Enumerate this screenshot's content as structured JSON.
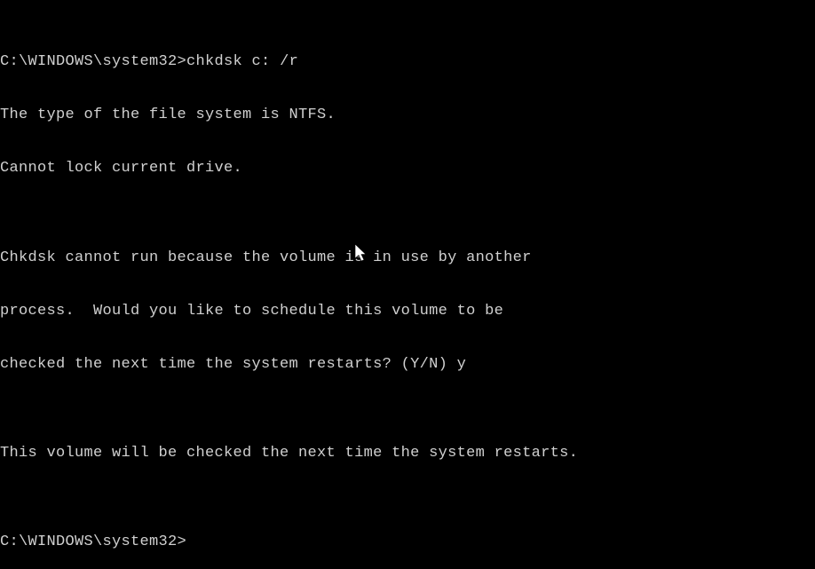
{
  "terminal": {
    "lines": [
      {
        "prompt": "C:\\WINDOWS\\system32>",
        "command": "chkdsk c: /r"
      },
      "The type of the file system is NTFS.",
      "Cannot lock current drive.",
      "",
      "Chkdsk cannot run because the volume is in use by another",
      "process.  Would you like to schedule this volume to be",
      "checked the next time the system restarts? (Y/N) y",
      "",
      "This volume will be checked the next time the system restarts.",
      ""
    ],
    "active_prompt": "C:\\WINDOWS\\system32>",
    "active_input": ""
  }
}
